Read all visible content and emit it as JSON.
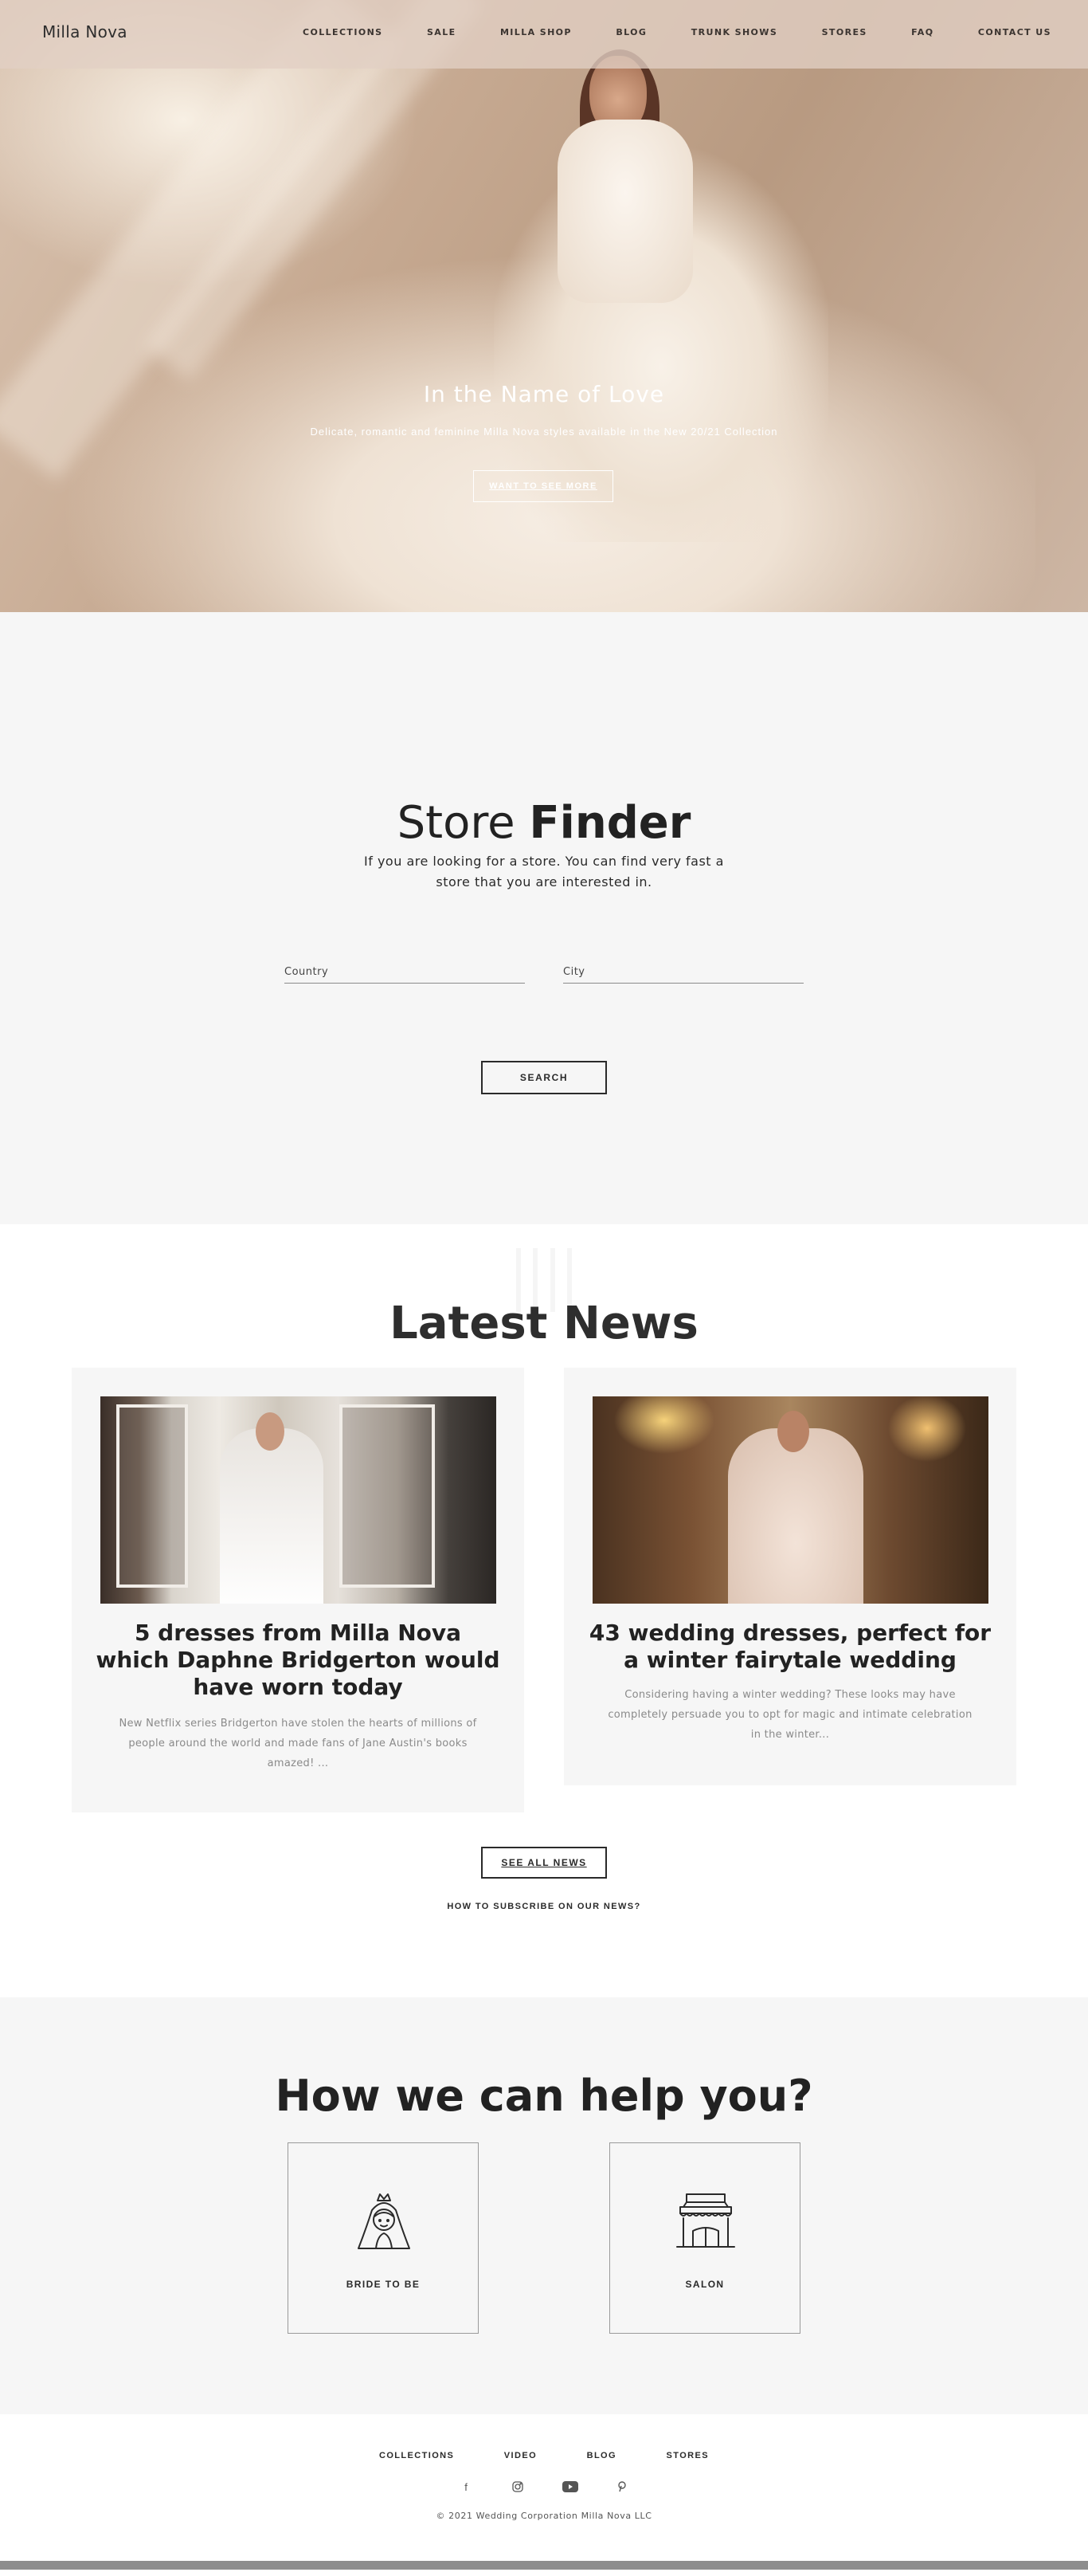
{
  "header": {
    "logo": "Milla Nova",
    "nav": [
      "COLLECTIONS",
      "SALE",
      "MILLA SHOP",
      "BLOG",
      "TRUNK SHOWS",
      "STORES",
      "FAQ",
      "CONTACT US"
    ]
  },
  "hero": {
    "title": "In the Name of Love",
    "subtitle": "Delicate, romantic and feminine Milla Nova styles available in the New 20/21 Collection",
    "button": "WANT TO SEE MORE"
  },
  "store_finder": {
    "title_light": "Store ",
    "title_bold": "Finder",
    "description": "If you are looking for a store. You can find very fast a store that you are interested in.",
    "country_placeholder": "Country",
    "city_placeholder": "City",
    "search_button": "SEARCH"
  },
  "news": {
    "title_bold": "Latest",
    "title_light": " News",
    "articles": [
      {
        "title": "5 dresses from Milla Nova which Daphne Bridgerton would have worn today",
        "excerpt": "New Netflix series Bridgerton have stolen the hearts of millions of people around the world and made fans of Jane Austin's books amazed! ..."
      },
      {
        "title": "43 wedding dresses, perfect for a winter fairytale wedding",
        "excerpt": "Considering having a winter wedding? These looks may have completely persuade you to opt for magic and intimate celebration in the winter..."
      }
    ],
    "see_all_button": "SEE ALL NEWS",
    "subscribe_link": "HOW TO SUBSCRIBE ON OUR NEWS?"
  },
  "help": {
    "title": "How we can help you?",
    "cards": [
      {
        "label": "BRIDE TO BE",
        "icon": "bride-icon"
      },
      {
        "label": "SALON",
        "icon": "salon-icon"
      }
    ]
  },
  "footer": {
    "nav": [
      "COLLECTIONS",
      "VIDEO",
      "BLOG",
      "STORES"
    ],
    "socials": [
      "facebook-icon",
      "instagram-icon",
      "youtube-icon",
      "pinterest-icon"
    ],
    "copyright": "© 2021 Wedding Corporation Milla Nova LLC"
  }
}
